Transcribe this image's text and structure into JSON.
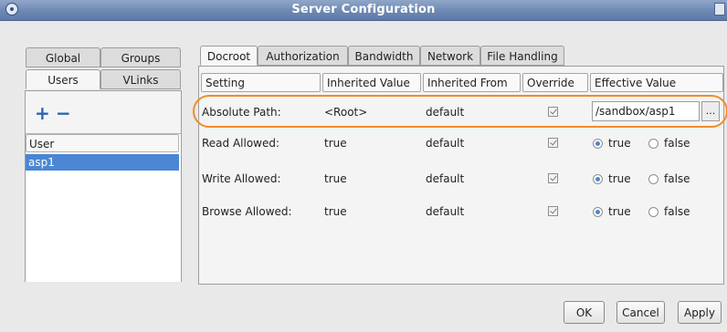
{
  "window": {
    "title": "Server Configuration"
  },
  "left_tabs": [
    {
      "label": "Global"
    },
    {
      "label": "Groups"
    },
    {
      "label": "Users",
      "active": true
    },
    {
      "label": "VLinks"
    }
  ],
  "users": {
    "add_label": "+",
    "remove_label": "−",
    "header": "User",
    "rows": [
      "asp1"
    ],
    "selected": "asp1"
  },
  "right_tabs": [
    {
      "label": "Docroot",
      "active": true
    },
    {
      "label": "Authorization"
    },
    {
      "label": "Bandwidth"
    },
    {
      "label": "Network"
    },
    {
      "label": "File Handling"
    }
  ],
  "table": {
    "columns": [
      "Setting",
      "Inherited Value",
      "Inherited From",
      "Override",
      "Effective Value"
    ],
    "rows": [
      {
        "setting": "Absolute Path:",
        "inherited_value": "<Root>",
        "inherited_from": "default",
        "override": true,
        "effective_value": "/sandbox/asp1",
        "browse_label": "..."
      },
      {
        "setting": "Read Allowed:",
        "inherited_value": "true",
        "inherited_from": "default",
        "override": true,
        "true_label": "true",
        "false_label": "false",
        "selected": "true"
      },
      {
        "setting": "Write Allowed:",
        "inherited_value": "true",
        "inherited_from": "default",
        "override": true,
        "true_label": "true",
        "false_label": "false",
        "selected": "true"
      },
      {
        "setting": "Browse Allowed:",
        "inherited_value": "true",
        "inherited_from": "default",
        "override": true,
        "true_label": "true",
        "false_label": "false",
        "selected": "true"
      }
    ]
  },
  "buttons": {
    "ok": "OK",
    "cancel": "Cancel",
    "apply": "Apply"
  },
  "colors": {
    "titlebar": "#6d88b3",
    "selection": "#4a86d4",
    "highlight": "#f08c28",
    "accent_icon": "#2b63b6"
  }
}
